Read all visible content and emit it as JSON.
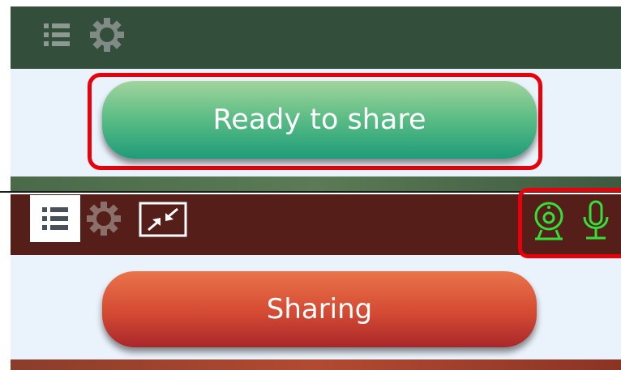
{
  "ready_panel": {
    "status_button_label": "Ready to share",
    "icons": [
      "list-icon",
      "gear-icon"
    ],
    "colors": {
      "toolbar": "#334f3b",
      "button_top": "#a3d49e",
      "button_bottom": "#1f9c79"
    }
  },
  "sharing_panel": {
    "status_button_label": "Sharing",
    "icons": [
      "list-icon",
      "gear-icon",
      "minimize-icon",
      "webcam-icon",
      "microphone-icon"
    ],
    "colors": {
      "toolbar": "#561e19",
      "button_top": "#e9744a",
      "button_bottom": "#a8272a",
      "device_icons": "#33e03a"
    }
  },
  "highlight_color": "#e8000b"
}
